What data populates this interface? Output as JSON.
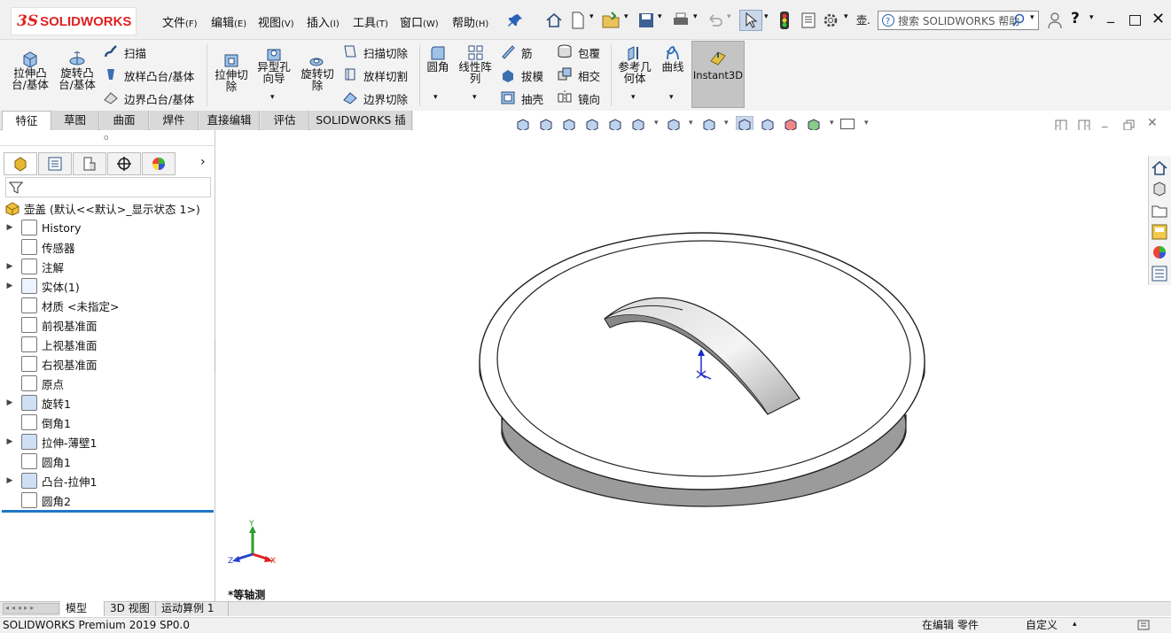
{
  "app": {
    "brand_ds": "3S",
    "brand_name": "SOLIDWORKS"
  },
  "menu": [
    {
      "label": "文件",
      "key": "(F)"
    },
    {
      "label": "编辑",
      "key": "(E)"
    },
    {
      "label": "视图",
      "key": "(V)"
    },
    {
      "label": "插入",
      "key": "(I)"
    },
    {
      "label": "工具",
      "key": "(T)"
    },
    {
      "label": "窗口",
      "key": "(W)"
    },
    {
      "label": "帮助",
      "key": "(H)"
    }
  ],
  "search": {
    "placeholder": "搜索 SOLIDWORKS 帮助"
  },
  "toolbar": {
    "extrude_boss": "拉伸凸台/基体",
    "revolve_boss": "旋转凸台/基体",
    "sweep": "扫描",
    "loft": "放样凸台/基体",
    "boundary": "边界凸台/基体",
    "extrude_cut": "拉伸切除",
    "hole_wizard": "异型孔向导",
    "revolve_cut": "旋转切除",
    "sweep_cut": "扫描切除",
    "loft_cut": "放样切割",
    "boundary_cut": "边界切除",
    "fillet": "圆角",
    "linear_pattern": "线性阵列",
    "rib": "筋",
    "draft": "拔模",
    "shell": "抽壳",
    "wrap": "包覆",
    "intersect": "相交",
    "mirror": "镜向",
    "ref_geometry": "参考几何体",
    "curves": "曲线",
    "instant3d": "Instant3D"
  },
  "tabs": [
    "特征",
    "草图",
    "曲面",
    "焊件",
    "直接编辑",
    "评估",
    "SOLIDWORKS 插件"
  ],
  "tree": {
    "root": "壶盖  (默认<<默认>_显示状态 1>)",
    "items": [
      {
        "label": "History",
        "expand": true
      },
      {
        "label": "传感器",
        "expand": false
      },
      {
        "label": "注解",
        "expand": true
      },
      {
        "label": "实体(1)",
        "expand": true
      },
      {
        "label": "材质 <未指定>",
        "expand": false
      },
      {
        "label": "前视基准面",
        "expand": false
      },
      {
        "label": "上视基准面",
        "expand": false
      },
      {
        "label": "右视基准面",
        "expand": false
      },
      {
        "label": "原点",
        "expand": false
      },
      {
        "label": "旋转1",
        "expand": true
      },
      {
        "label": "倒角1",
        "expand": false
      },
      {
        "label": "拉伸-薄壁1",
        "expand": true
      },
      {
        "label": "圆角1",
        "expand": false
      },
      {
        "label": "凸台-拉伸1",
        "expand": true
      },
      {
        "label": "圆角2",
        "expand": false
      }
    ]
  },
  "viewport": {
    "view_name": "*等轴测",
    "axis_x": "X",
    "axis_y": "Y",
    "axis_z": "Z"
  },
  "bottom_tabs": [
    "模型",
    "3D 视图",
    "运动算例 1"
  ],
  "status": {
    "product": "SOLIDWORKS Premium 2019 SP0.0",
    "mode": "在编辑 零件",
    "units": "自定义"
  },
  "colors": {
    "accent": "#1e78c8",
    "brand": "#d22222",
    "instant3d_bg": "#c4c4c4"
  }
}
